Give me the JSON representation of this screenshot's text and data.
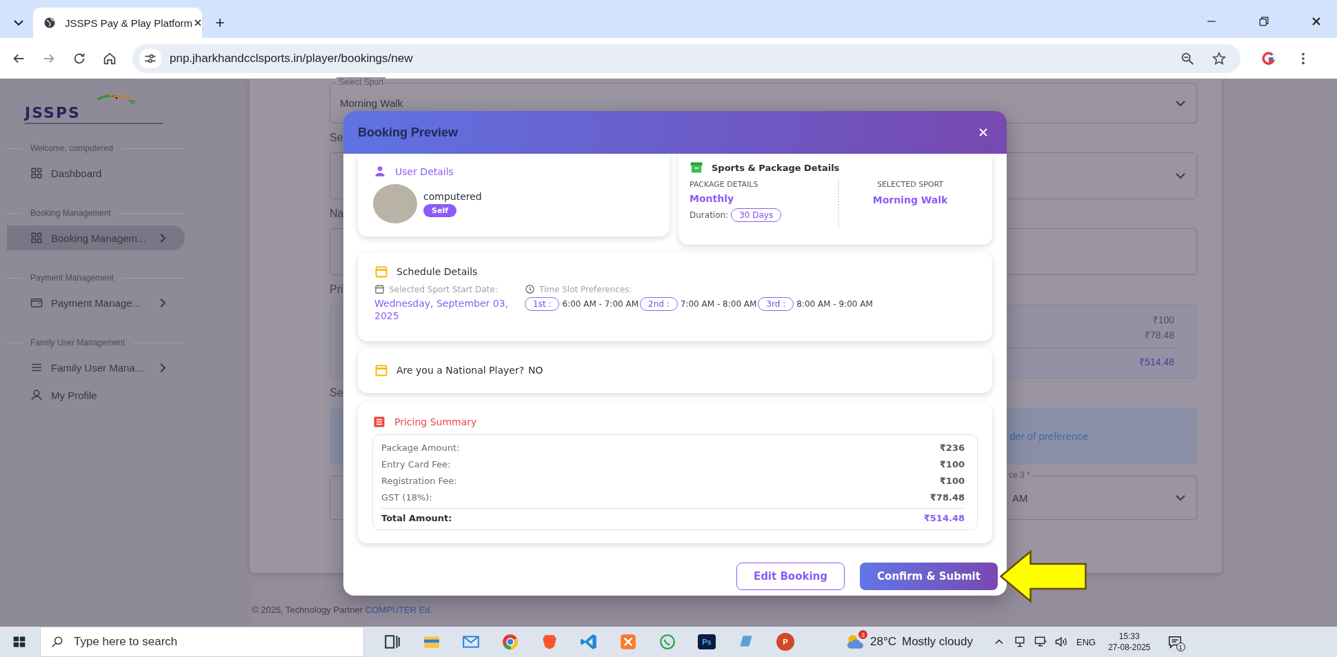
{
  "browser": {
    "tabs": [
      {
        "title": "JSSPS Pay & Play Platform",
        "selected": true
      }
    ],
    "url": "pnp.jharkhandcclsports.in/player/bookings/new"
  },
  "sidebar": {
    "logo": "JSSPS",
    "items": [
      {
        "kind": "section",
        "label": "Welcome, computered"
      },
      {
        "kind": "link",
        "label": "Dashboard",
        "selected": false,
        "submenu": false
      },
      {
        "kind": "section",
        "label": "Booking Management"
      },
      {
        "kind": "link",
        "label": "Booking Managem...",
        "selected": true,
        "submenu": true
      },
      {
        "kind": "section",
        "label": "Payment Management"
      },
      {
        "kind": "link",
        "label": "Payment Manage...",
        "selected": false,
        "submenu": true
      },
      {
        "kind": "section",
        "label": "Family User Management"
      },
      {
        "kind": "link",
        "label": "Family User Mana...",
        "selected": false,
        "submenu": true
      },
      {
        "kind": "link",
        "label": "My Profile",
        "selected": false,
        "submenu": false
      }
    ]
  },
  "form": {
    "items": [
      {
        "kind": "select",
        "label": "Select Sport",
        "value": "Morning Walk"
      },
      {
        "kind": "heading",
        "text": "Se"
      },
      {
        "kind": "select"
      },
      {
        "kind": "heading",
        "text": "Na"
      },
      {
        "kind": "textarea"
      },
      {
        "kind": "heading",
        "text": "Pri"
      },
      {
        "kind": "prices",
        "lines": [
          "₹100",
          "₹78.48"
        ],
        "total": "₹514.48"
      },
      {
        "kind": "heading",
        "text": "Se"
      },
      {
        "kind": "info",
        "text": "der of preference"
      },
      {
        "kind": "select_partial",
        "label": "ce 3 *",
        "value": "AM"
      }
    ]
  },
  "footer": {
    "text": "© 2025, Technology Partner",
    "link": "COMPUTER Ed."
  },
  "modal": {
    "title": "Booking Preview",
    "user_details": {
      "heading": "User Details",
      "name": "computered",
      "badge": "Self"
    },
    "sports": {
      "heading": "Sports & Package Details",
      "package_label": "PACKAGE DETAILS",
      "package_value": "Monthly",
      "duration_label": "Duration:",
      "duration_value": "30 Days",
      "sport_label": "SELECTED SPORT",
      "sport_value": "Morning Walk"
    },
    "schedule": {
      "heading": "Schedule Details",
      "date_label": "Selected Sport Start Date:",
      "slot_label": "Time Slot Preferences:",
      "date": "Wednesday, September 03, 2025",
      "slots": [
        {
          "rank": "1st :",
          "time": "6:00 AM - 7:00 AM"
        },
        {
          "rank": "2nd :",
          "time": "7:00 AM - 8:00 AM"
        },
        {
          "rank": "3rd :",
          "time": "8:00 AM - 9:00 AM"
        }
      ]
    },
    "national": {
      "question": "Are you a National Player?",
      "answer": "NO"
    },
    "pricing": {
      "heading": "Pricing Summary",
      "rows": [
        {
          "label": "Package Amount:",
          "value": "₹236"
        },
        {
          "label": "Entry Card Fee:",
          "value": "₹100"
        },
        {
          "label": "Registration Fee:",
          "value": "₹100"
        },
        {
          "label": "GST (18%):",
          "value": "₹78.48"
        }
      ],
      "total": {
        "label": "Total Amount:",
        "value": "₹514.48"
      }
    },
    "buttons": [
      {
        "kind": "secondary",
        "label": "Edit Booking"
      },
      {
        "kind": "primary",
        "label": "Confirm & Submit"
      }
    ]
  },
  "taskbar": {
    "search_placeholder": "Type here to search",
    "apps": [
      {
        "kind": "taskview"
      },
      {
        "kind": "explorer"
      },
      {
        "kind": "mail"
      },
      {
        "kind": "chrome"
      },
      {
        "kind": "brave"
      },
      {
        "kind": "vscode"
      },
      {
        "kind": "xampp"
      },
      {
        "kind": "whatsapp"
      },
      {
        "kind": "photoshop",
        "glyph": "Ps"
      },
      {
        "kind": "notes"
      },
      {
        "kind": "powerpoint",
        "glyph": "P"
      }
    ],
    "weather": {
      "badge": "3",
      "temperature": "28°C",
      "condition": "Mostly cloudy"
    },
    "language": "ENG",
    "time": "15:33",
    "date": "27-08-2025",
    "notifications": "1"
  }
}
